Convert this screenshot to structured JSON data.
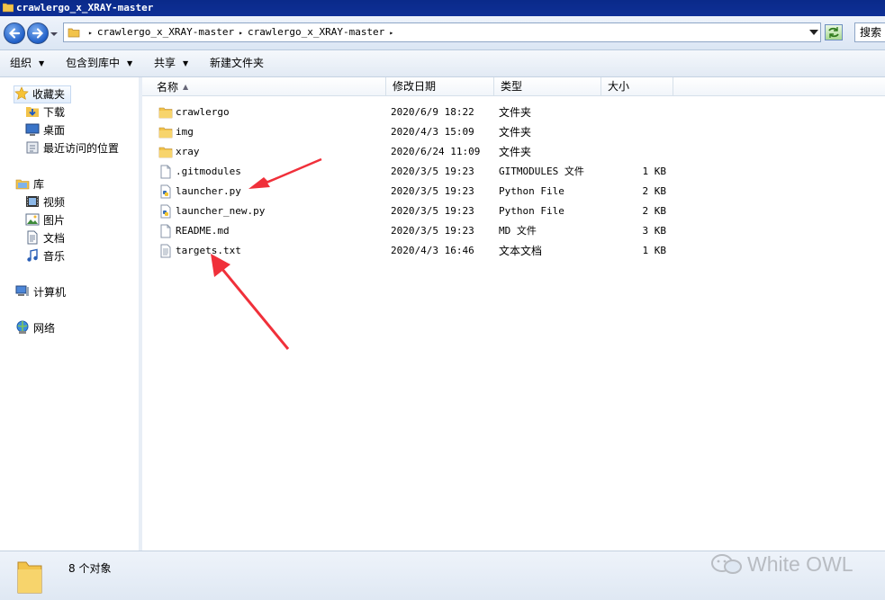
{
  "window": {
    "title": "crawlergo_x_XRAY-master"
  },
  "address": {
    "crumbs": [
      "crawlergo_x_XRAY-master",
      "crawlergo_x_XRAY-master"
    ],
    "search_label": "搜索"
  },
  "toolbar": {
    "organize": "组织",
    "include_library": "包含到库中",
    "share": "共享",
    "new_folder": "新建文件夹"
  },
  "nav": {
    "favorites": "收藏夹",
    "downloads": "下载",
    "desktop": "桌面",
    "recent": "最近访问的位置",
    "libraries": "库",
    "videos": "视频",
    "pictures": "图片",
    "documents": "文档",
    "music": "音乐",
    "computer": "计算机",
    "network": "网络"
  },
  "columns": {
    "name": "名称",
    "date": "修改日期",
    "type": "类型",
    "size": "大小"
  },
  "files": [
    {
      "name": "crawlergo",
      "date": "2020/6/9 18:22",
      "type": "文件夹",
      "size": "",
      "icon": "folder-icon"
    },
    {
      "name": "img",
      "date": "2020/4/3 15:09",
      "type": "文件夹",
      "size": "",
      "icon": "folder-icon"
    },
    {
      "name": "xray",
      "date": "2020/6/24 11:09",
      "type": "文件夹",
      "size": "",
      "icon": "folder-icon"
    },
    {
      "name": ".gitmodules",
      "date": "2020/3/5 19:23",
      "type": "GITMODULES 文件",
      "size": "1 KB",
      "icon": "file-icon"
    },
    {
      "name": "launcher.py",
      "date": "2020/3/5 19:23",
      "type": "Python File",
      "size": "2 KB",
      "icon": "python-file-icon"
    },
    {
      "name": "launcher_new.py",
      "date": "2020/3/5 19:23",
      "type": "Python File",
      "size": "2 KB",
      "icon": "python-file-icon"
    },
    {
      "name": "README.md",
      "date": "2020/3/5 19:23",
      "type": "MD 文件",
      "size": "3 KB",
      "icon": "file-icon"
    },
    {
      "name": "targets.txt",
      "date": "2020/4/3 16:46",
      "type": "文本文档",
      "size": "1 KB",
      "icon": "text-file-icon"
    }
  ],
  "status": {
    "count": "8 个对象"
  },
  "watermark": "White OWL",
  "colors": {
    "annotation_arrow": "#f0303a",
    "titlebar": "#0e2f96"
  }
}
